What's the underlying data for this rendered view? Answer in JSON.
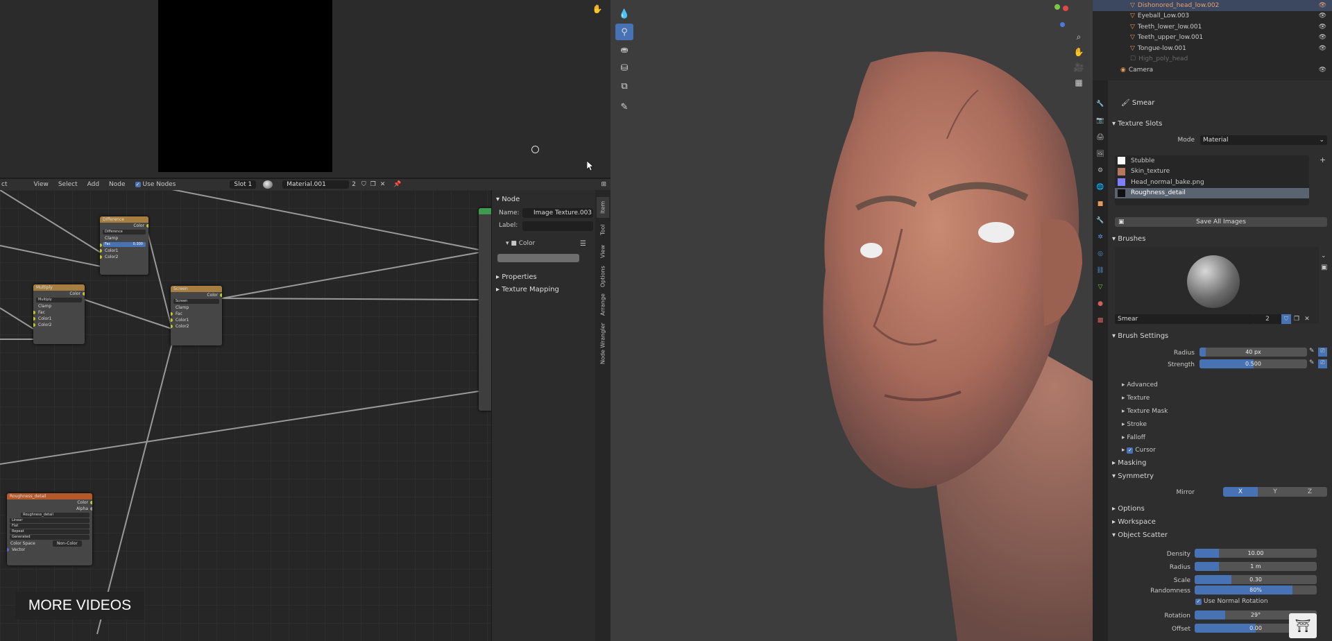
{
  "node_header": {
    "menu": [
      "ct",
      "View",
      "Select",
      "Add",
      "Node"
    ],
    "use_nodes": "Use Nodes",
    "slot": "Slot 1",
    "material": "Material.001",
    "users": "2"
  },
  "nodes": {
    "difference": {
      "title": "Difference",
      "out": "Color",
      "mode": "Difference",
      "clamp": "Clamp",
      "fac": "Fac",
      "fac_val": "0.300",
      "c1": "Color1",
      "c2": "Color2"
    },
    "multiply": {
      "title": "Multiply",
      "out": "Color",
      "mode": "Multiply",
      "clamp": "Clamp",
      "fac": "Fac",
      "c1": "Color1",
      "c2": "Color2"
    },
    "screen": {
      "title": "Screen",
      "out": "Color",
      "mode": "Screen",
      "clamp": "Clamp",
      "fac": "Fac",
      "c1": "Color1",
      "c2": "Color2"
    },
    "roughness": {
      "title": "Roughness_detail",
      "out_color": "Color",
      "out_alpha": "Alpha",
      "image": "Roughness_detail",
      "interp": "Linear",
      "proj": "Flat",
      "ext": "Repeat",
      "source": "Generated",
      "cs_label": "Color Space",
      "cs_val": "Non-Color",
      "vector": "Vector"
    }
  },
  "n_panel": {
    "node_section": "Node",
    "name_label": "Name:",
    "name_value": "Image Texture.003",
    "label_label": "Label:",
    "color": "Color",
    "properties": "Properties",
    "texture_mapping": "Texture Mapping",
    "tabs": [
      "Item",
      "Tool",
      "View",
      "Options",
      "Arrange",
      "Node Wrangler"
    ]
  },
  "outliner": {
    "rows": [
      {
        "name": "Dishonored_head_low.002",
        "highlight": true
      },
      {
        "name": "Eyeball_Low.003"
      },
      {
        "name": "Teeth_lower_low.001"
      },
      {
        "name": "Teeth_upper_low.001"
      },
      {
        "name": "Tongue-low.001"
      },
      {
        "name": "High_poly_head",
        "dim": true
      },
      {
        "name": "Camera"
      }
    ]
  },
  "props": {
    "brush_name": "Smear",
    "texture_slots": "Texture Slots",
    "mode_label": "Mode",
    "mode_value": "Material",
    "slots": [
      "Stubble",
      "Skin_texture",
      "Head_normal_bake.png",
      "Roughness_detail"
    ],
    "save_all": "Save All Images",
    "brushes": "Brushes",
    "brush_field": "Smear",
    "brush_users": "2",
    "brush_settings": "Brush Settings",
    "radius_label": "Radius",
    "radius_value": "40 px",
    "strength_label": "Strength",
    "strength_value": "0.500",
    "subs": [
      "Advanced",
      "Texture",
      "Texture Mask",
      "Stroke",
      "Falloff"
    ],
    "cursor": "Cursor",
    "masking": "Masking",
    "symmetry": "Symmetry",
    "mirror_label": "Mirror",
    "mirror": [
      "X",
      "Y",
      "Z"
    ],
    "options": "Options",
    "workspace": "Workspace",
    "object_scatter": "Object Scatter",
    "scatter": [
      {
        "label": "Density",
        "value": "10.00",
        "fill": 0.2
      },
      {
        "label": "Radius",
        "value": "1 m",
        "fill": 0.2
      },
      {
        "label": "Scale",
        "value": "0.30",
        "fill": 0.3
      },
      {
        "label": "Randomness",
        "value": "80%",
        "fill": 0.8
      }
    ],
    "use_normal_rotation": "Use Normal Rotation",
    "rotation_label": "Rotation",
    "rotation_value": "29°",
    "offset_label": "Offset",
    "offset_value": "0.00"
  },
  "overlay": {
    "more_videos": "MORE VIDEOS"
  }
}
